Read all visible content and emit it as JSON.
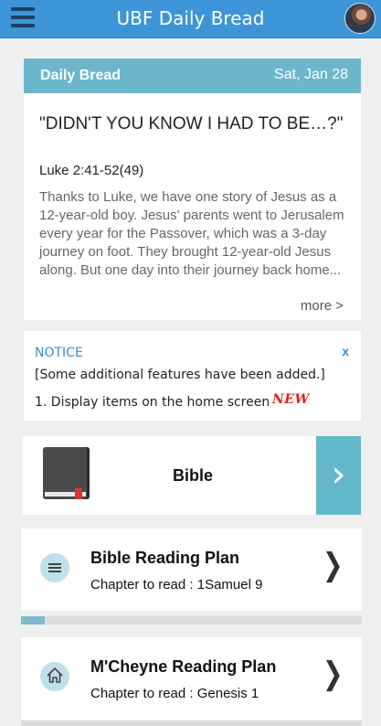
{
  "app": {
    "title": "UBF Daily Bread"
  },
  "daily": {
    "label": "Daily Bread",
    "date": "Sat, Jan 28",
    "title": "\"DIDN'T YOU KNOW I HAD TO BE…?\"",
    "reference": "Luke 2:41-52(49)",
    "excerpt": "Thanks to Luke, we have one story of Jesus as a 12-year-old boy. Jesus' parents went to Jerusalem every year for the Passover, which was a 3-day journey on foot. They brought 12-year-old Jesus along. But one day into their journey back home...",
    "more": "more >"
  },
  "notice": {
    "title": "NOTICE",
    "close": "x",
    "line1": "[Some additional features have been added.]",
    "line2": "1. Display items on the home screen",
    "badge": "NEW"
  },
  "bible": {
    "label": "Bible",
    "arrow": "›"
  },
  "plans": [
    {
      "name": "Bible Reading Plan",
      "subtitle": "Chapter to read : 1Samuel 9",
      "icon": "list-icon",
      "chevron": "❯"
    },
    {
      "name": "M'Cheyne Reading Plan",
      "subtitle": "Chapter to read : Genesis 1",
      "icon": "home-icon",
      "chevron": "❯"
    }
  ],
  "reading_progress": 0.07,
  "colors": {
    "appbar": "#3d95d8",
    "daily_header": "#6cb6cc",
    "accent": "#62b7cb",
    "notice_blue": "#3a8cd0",
    "new_red": "#e0201e"
  }
}
